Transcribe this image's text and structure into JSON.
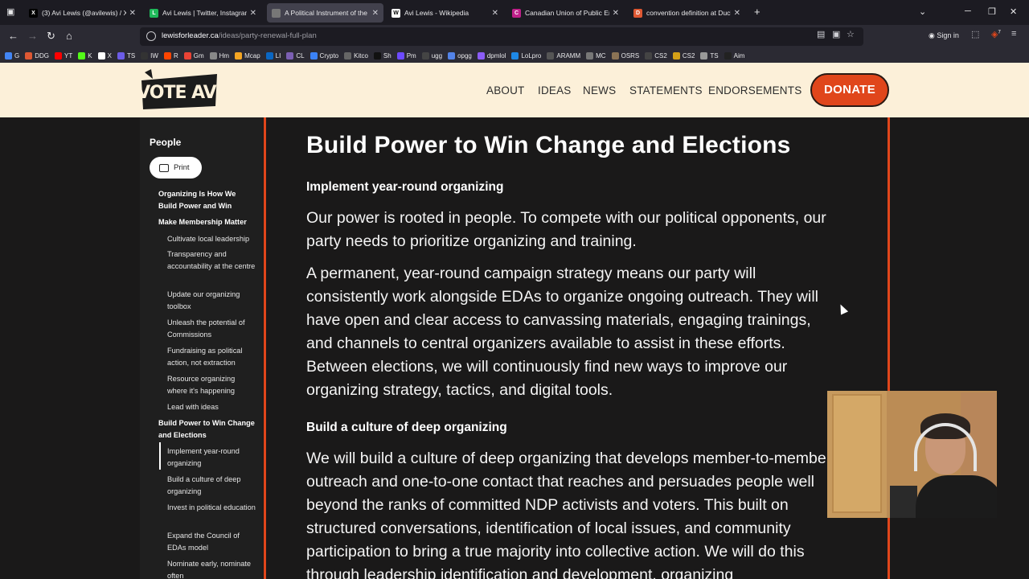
{
  "browser": {
    "tabs": [
      {
        "title": "(3) Avi Lewis (@avilewis) / X",
        "fav": "X",
        "color": "#000000"
      },
      {
        "title": "Avi Lewis | Twitter, Instagram, Fa",
        "fav": "L",
        "color": "#1fb95a"
      },
      {
        "title": "A Political Instrument of the Pe",
        "fav": "",
        "color": "#777777"
      },
      {
        "title": "Avi Lewis - Wikipedia",
        "fav": "W",
        "color": "#ffffff"
      },
      {
        "title": "Canadian Union of Public Emplo",
        "fav": "C",
        "color": "#c0208a"
      },
      {
        "title": "convention definition at DuckDu",
        "fav": "D",
        "color": "#de5833"
      }
    ],
    "new_tab_symbol": "+",
    "url_host": "lewisforleader.ca",
    "url_path": "/ideas/party-renewal-full-plan",
    "sign_in": "Sign in",
    "extension_badge": "7",
    "bookmarks": [
      {
        "label": "G",
        "color": "#4285f4"
      },
      {
        "label": "DDG",
        "color": "#de5833"
      },
      {
        "label": "YT",
        "color": "#ff0000"
      },
      {
        "label": "K",
        "color": "#53fc18"
      },
      {
        "label": "X",
        "color": "#ffffff"
      },
      {
        "label": "TS",
        "color": "#6c5ce7"
      },
      {
        "label": "IW",
        "color": "#333333"
      },
      {
        "label": "R",
        "color": "#ff4500"
      },
      {
        "label": "Gm",
        "color": "#ea4335"
      },
      {
        "label": "Hm",
        "color": "#888888"
      },
      {
        "label": "Mcap",
        "color": "#f5a623"
      },
      {
        "label": "LI",
        "color": "#0a66c2"
      },
      {
        "label": "CL",
        "color": "#7b5fb3"
      },
      {
        "label": "Crypto",
        "color": "#3b82f6"
      },
      {
        "label": "Kitco",
        "color": "#666666"
      },
      {
        "label": "Sh",
        "color": "#111111"
      },
      {
        "label": "Pm",
        "color": "#6d4aff"
      },
      {
        "label": "ugg",
        "color": "#444444"
      },
      {
        "label": "opgg",
        "color": "#5383e8"
      },
      {
        "label": "dpmlol",
        "color": "#8b5cf6"
      },
      {
        "label": "LoLpro",
        "color": "#1e88e5"
      },
      {
        "label": "ARAMM",
        "color": "#555555"
      },
      {
        "label": "MC",
        "color": "#777777"
      },
      {
        "label": "OSRS",
        "color": "#8b7355"
      },
      {
        "label": "CS2",
        "color": "#444444"
      },
      {
        "label": "CS2",
        "color": "#d4a017"
      },
      {
        "label": "TS",
        "color": "#999999"
      },
      {
        "label": "Aim",
        "color": "#222222"
      }
    ]
  },
  "site": {
    "logo_text": "VOTE AVI",
    "nav": [
      "ABOUT",
      "IDEAS",
      "NEWS",
      "STATEMENTS",
      "ENDORSEMENTS"
    ],
    "donate": "DONATE",
    "brand_orange": "#e0461b",
    "header_bg": "#fcf0d9"
  },
  "sidebar": {
    "title": "People",
    "print": "Print",
    "toc": [
      {
        "text": "Organizing Is How We Build Power and Win",
        "level": "b"
      },
      {
        "text": "Make Membership Matter",
        "level": "b"
      },
      {
        "text": "Cultivate local leadership",
        "level": "s"
      },
      {
        "text": "Transparency and accountability at the centre",
        "level": "s"
      },
      {
        "text": "Update our organizing toolbox",
        "level": "s"
      },
      {
        "text": "Unleash the potential of Commissions",
        "level": "s"
      },
      {
        "text": "Fundraising as political action, not extraction",
        "level": "s"
      },
      {
        "text": "Resource organizing where it's happening",
        "level": "s"
      },
      {
        "text": "Lead with ideas",
        "level": "s"
      },
      {
        "text": "Build Power to Win Change and Elections",
        "level": "b"
      },
      {
        "text": "Implement year-round organizing",
        "level": "s"
      },
      {
        "text": "Build a culture of deep organizing",
        "level": "s"
      },
      {
        "text": "Invest in political education",
        "level": "s"
      },
      {
        "text": "Expand the Council of EDAs model",
        "level": "s"
      },
      {
        "text": "Nominate early, nominate often",
        "level": "s"
      }
    ]
  },
  "article": {
    "title": "Build Power to Win Change and Elections",
    "section1": "Implement year-round organizing",
    "p1": "Our power is rooted in people. To compete with our political opponents, our party needs to prioritize organizing and training.",
    "p2": "A permanent, year-round campaign strategy means our party will consistently work alongside EDAs to organize ongoing outreach. They will have open and clear access to canvassing materials, engaging trainings, and channels to central organizers available to assist in these efforts. Between elections, we will continuously find new ways to improve our organizing strategy, tactics, and digital tools.",
    "section2": "Build a culture of deep organizing",
    "p3": "We will build a culture of deep organizing that develops member-to-member outreach and one-to-one contact that reaches and persuades people well beyond the ranks of committed NDP activists and voters. This built on structured conversations, identification of local issues, and community participation to bring a true majority into collective action. We will do this through leadership identification and development, organizing"
  }
}
